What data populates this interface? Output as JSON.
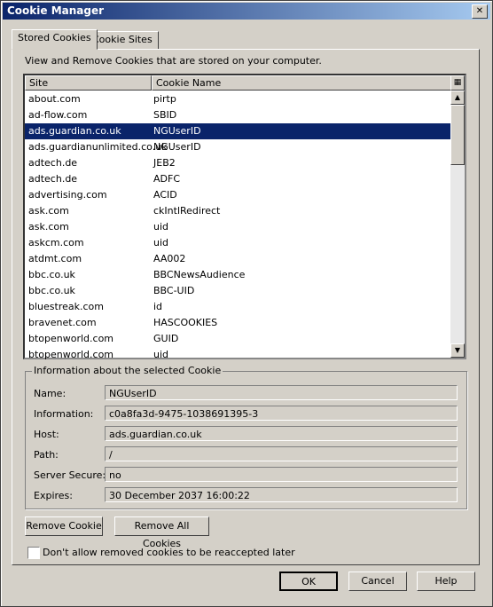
{
  "window": {
    "title": "Cookie Manager",
    "close": "✕"
  },
  "tabs": [
    {
      "label": "Stored Cookies"
    },
    {
      "label": "Cookie Sites"
    }
  ],
  "description": "View and Remove Cookies that are stored on your computer.",
  "table": {
    "headers": [
      "Site",
      "Cookie Name"
    ],
    "rows": [
      [
        "about.com",
        "pirtp"
      ],
      [
        "ad-flow.com",
        "SBID"
      ],
      [
        "ads.guardian.co.uk",
        "NGUserID"
      ],
      [
        "ads.guardianunlimited.co.uk",
        "NGUserID"
      ],
      [
        "adtech.de",
        "JEB2"
      ],
      [
        "adtech.de",
        "ADFC"
      ],
      [
        "advertising.com",
        "ACID"
      ],
      [
        "ask.com",
        "ckIntlRedirect"
      ],
      [
        "ask.com",
        "uid"
      ],
      [
        "askcm.com",
        "uid"
      ],
      [
        "atdmt.com",
        "AA002"
      ],
      [
        "bbc.co.uk",
        "BBCNewsAudience"
      ],
      [
        "bbc.co.uk",
        "BBC-UID"
      ],
      [
        "bluestreak.com",
        "id"
      ],
      [
        "bravenet.com",
        "HASCOOKIES"
      ],
      [
        "btopenworld.com",
        "GUID"
      ],
      [
        "btopenworld.com",
        "uid"
      ]
    ],
    "selected_index": 2
  },
  "info": {
    "group_label": "Information about the selected Cookie",
    "fields": [
      {
        "label": "Name:",
        "value": "NGUserID"
      },
      {
        "label": "Information:",
        "value": "c0a8fa3d-9475-1038691395-3"
      },
      {
        "label": "Host:",
        "value": "ads.guardian.co.uk"
      },
      {
        "label": "Path:",
        "value": "/"
      },
      {
        "label": "Server Secure:",
        "value": "no"
      },
      {
        "label": "Expires:",
        "value": "30 December 2037 16:00:22"
      }
    ]
  },
  "buttons": {
    "remove_cookie": "Remove Cookie",
    "remove_all": "Remove All Cookies",
    "ok": "OK",
    "cancel": "Cancel",
    "help": "Help"
  },
  "checkbox": {
    "label": "Don't allow removed cookies to be reaccepted later",
    "checked": false
  }
}
